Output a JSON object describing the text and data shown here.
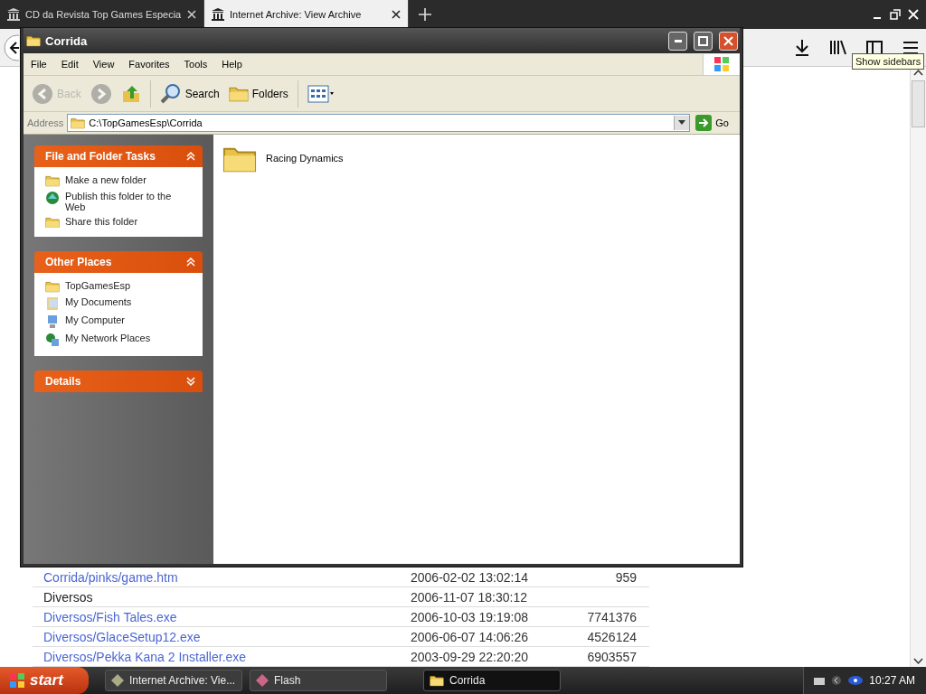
{
  "browser": {
    "tabs": [
      {
        "label": "CD da Revista Top Games Especia",
        "selected": false
      },
      {
        "label": "Internet Archive: View Archive",
        "selected": true
      }
    ],
    "tooltip": "Show sidebars",
    "rows": [
      {
        "kind": "link",
        "name": "Corrida/pinks/game.htm",
        "date": "2006-02-02 13:02:14",
        "size": "959"
      },
      {
        "kind": "folder",
        "name": "Diversos",
        "date": "2006-11-07 18:30:12"
      },
      {
        "kind": "link",
        "name": "Diversos/Fish Tales.exe",
        "date": "2006-10-03 19:19:08",
        "size": "7741376"
      },
      {
        "kind": "link",
        "name": "Diversos/GlaceSetup12.exe",
        "date": "2006-06-07 14:06:26",
        "size": "4526124"
      },
      {
        "kind": "link",
        "name": "Diversos/Pekka Kana 2 Installer.exe",
        "date": "2003-09-29 22:20:20",
        "size": "6903557"
      }
    ]
  },
  "explorer": {
    "title": "Corrida",
    "menu": [
      "File",
      "Edit",
      "View",
      "Favorites",
      "Tools",
      "Help"
    ],
    "toolbar": [
      {
        "kind": "back",
        "label": "Back",
        "disabled": true
      },
      {
        "kind": "forward",
        "disabled": true
      },
      {
        "kind": "up",
        "disabled": false
      },
      {
        "kind": "search",
        "label": "Search",
        "disabled": false
      },
      {
        "kind": "folders",
        "label": "Folders",
        "disabled": false
      },
      {
        "kind": "views",
        "disabled": false
      }
    ],
    "address": {
      "label": "Address",
      "path": "C:\\TopGamesEsp\\Corrida",
      "go": "Go"
    },
    "panels": [
      {
        "title": "File and Folder Tasks",
        "expanded": true,
        "items": [
          "Make a new folder",
          "Publish this folder to the Web",
          "Share this folder"
        ]
      },
      {
        "title": "Other Places",
        "expanded": true,
        "items": [
          "TopGamesEsp",
          "My Documents",
          "My Computer",
          "My Network Places"
        ]
      },
      {
        "title": "Details",
        "expanded": false
      }
    ],
    "files": [
      {
        "name": "Racing Dynamics"
      }
    ]
  },
  "taskbar": {
    "start": "start",
    "items": [
      {
        "label": "Internet Archive: Vie...",
        "selected": false
      },
      {
        "label": "Flash",
        "selected": false
      },
      {
        "label": "Corrida",
        "selected": true
      }
    ],
    "clock": "10:27 AM"
  }
}
